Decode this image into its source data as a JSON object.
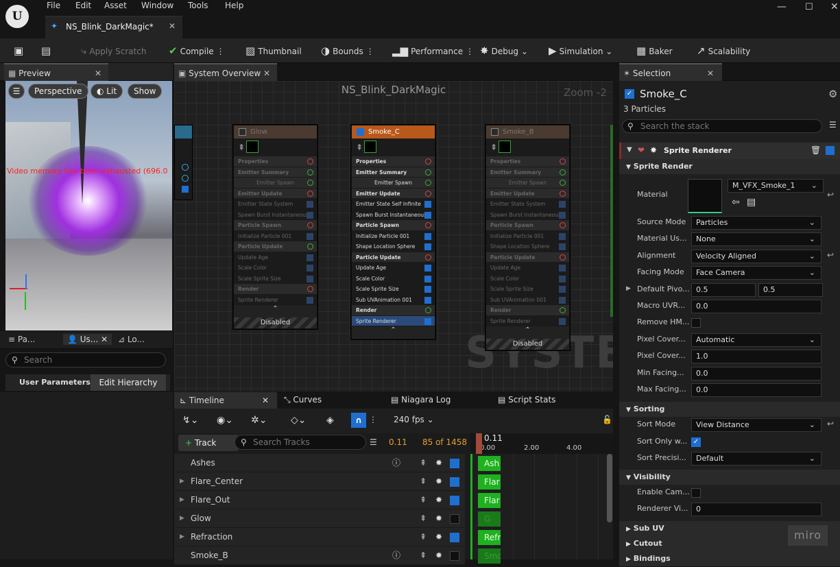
{
  "menu": [
    "File",
    "Edit",
    "Asset",
    "Window",
    "Tools",
    "Help"
  ],
  "doc_tab": "NS_Blink_DarkMagic*",
  "toolbar": {
    "apply_scratch": "Apply Scratch",
    "compile": "Compile",
    "thumbnail": "Thumbnail",
    "bounds": "Bounds",
    "performance": "Performance",
    "debug": "Debug",
    "simulation": "Simulation",
    "baker": "Baker",
    "scalability": "Scalability"
  },
  "preview": {
    "tab": "Preview",
    "perspective": "Perspective",
    "lit": "Lit",
    "show": "Show",
    "warning": "Video memory has been exhausted (696.0"
  },
  "params": {
    "tabs": [
      "Pa...",
      "Us...",
      "Lo..."
    ],
    "search_placeholder": "Search",
    "user_parameters": "User Parameters",
    "edit_hierarchy": "Edit Hierarchy"
  },
  "system_overview": {
    "tab": "System Overview",
    "title": "NS_Blink_DarkMagic",
    "zoom": "Zoom -2",
    "watermark": "SYSTEM"
  },
  "nodes": [
    {
      "name": "Glow",
      "enabled": false,
      "footer": "Disabled",
      "rows": [
        [
          "Properties",
          "sec"
        ],
        [
          "Emitter Summary",
          "sec"
        ],
        [
          "Emitter Spawn",
          "hdr"
        ],
        [
          "Emitter Update",
          "sec"
        ],
        [
          "Emitter State  System",
          ""
        ],
        [
          "Spawn Burst Instantaneous",
          ""
        ],
        [
          "Particle Spawn",
          "sec"
        ],
        [
          "Initialize Particle 001",
          ""
        ],
        [
          "Particle Update",
          "sec"
        ],
        [
          "Update Age",
          ""
        ],
        [
          "Scale Color",
          ""
        ],
        [
          "Scale Sprite Size",
          ""
        ],
        [
          "Render",
          "sec"
        ],
        [
          "Sprite Renderer",
          ""
        ]
      ]
    },
    {
      "name": "Smoke_C",
      "enabled": true,
      "footer": "",
      "rows": [
        [
          "Properties",
          "sec"
        ],
        [
          "Emitter Summary",
          "sec"
        ],
        [
          "Emitter Spawn",
          "hdr"
        ],
        [
          "Emitter Update",
          "sec"
        ],
        [
          "Emitter State  Self  Infinite",
          ""
        ],
        [
          "Spawn Burst Instantaneous",
          ""
        ],
        [
          "Particle Spawn",
          "sec"
        ],
        [
          "Initialize Particle 001",
          ""
        ],
        [
          "Shape Location  Sphere",
          ""
        ],
        [
          "Particle Update",
          "sec"
        ],
        [
          "Update Age",
          ""
        ],
        [
          "Scale Color",
          ""
        ],
        [
          "Scale Sprite Size",
          ""
        ],
        [
          "Sub UVAnimation 001",
          ""
        ],
        [
          "Render",
          "sec"
        ],
        [
          "Sprite Renderer",
          "sel"
        ]
      ]
    },
    {
      "name": "Smoke_B",
      "enabled": false,
      "footer": "Disabled",
      "rows": [
        [
          "Properties",
          "sec"
        ],
        [
          "Emitter Summary",
          "sec"
        ],
        [
          "Emitter Spawn",
          "hdr"
        ],
        [
          "Emitter Update",
          "sec"
        ],
        [
          "Emitter State  System",
          ""
        ],
        [
          "Spawn Burst Instantaneous",
          ""
        ],
        [
          "Particle Spawn",
          "sec"
        ],
        [
          "Initialize Particle 001",
          ""
        ],
        [
          "Shape Location  Sphere",
          ""
        ],
        [
          "Particle Update",
          "sec"
        ],
        [
          "Update Age",
          ""
        ],
        [
          "Scale Color",
          ""
        ],
        [
          "Scale Sprite Size",
          ""
        ],
        [
          "Sub UVAnimation 001",
          ""
        ],
        [
          "Render",
          "sec"
        ],
        [
          "Sprite Renderer",
          ""
        ]
      ]
    }
  ],
  "timeline": {
    "tabs": [
      "Timeline",
      "Curves",
      "Niagara Log",
      "Script Stats"
    ],
    "fps": "240 fps",
    "track_button": "Track",
    "search_placeholder": "Search Tracks",
    "time": "0.11",
    "frame": "85 of 1458",
    "playhead": "0.11",
    "ruler": [
      "0.00",
      "2.00",
      "4.00"
    ],
    "tracks": [
      {
        "name": "Ashes",
        "expand": false,
        "info": true,
        "enabled": true,
        "bar": "Ash"
      },
      {
        "name": "Flare_Center",
        "expand": true,
        "info": false,
        "enabled": true,
        "bar": "Flar"
      },
      {
        "name": "Flare_Out",
        "expand": true,
        "info": false,
        "enabled": true,
        "bar": "Flar"
      },
      {
        "name": "Glow",
        "expand": true,
        "info": false,
        "enabled": false,
        "bar": "G"
      },
      {
        "name": "Refraction",
        "expand": true,
        "info": false,
        "enabled": true,
        "bar": "Refr"
      },
      {
        "name": "Smoke_B",
        "expand": false,
        "info": true,
        "enabled": false,
        "bar": "Smo"
      }
    ]
  },
  "selection": {
    "tab": "Selection",
    "title": "Smoke_C",
    "count": "3 Particles",
    "search_placeholder": "Search the stack",
    "renderer": "Sprite Renderer",
    "group": "Sprite Render",
    "material": "M_VFX_Smoke_1",
    "props": [
      {
        "label": "Source Mode",
        "value": "Particles",
        "type": "select"
      },
      {
        "label": "Material Us...",
        "value": "None",
        "type": "select"
      },
      {
        "label": "Alignment",
        "value": "Velocity Aligned",
        "type": "select"
      },
      {
        "label": "Facing Mode",
        "value": "Face Camera",
        "type": "select"
      },
      {
        "label": "Default Pivo...",
        "value": "0.5",
        "value2": "0.5",
        "type": "pair"
      },
      {
        "label": "Macro UVR...",
        "value": "0.0",
        "type": "text"
      },
      {
        "label": "Remove HM...",
        "type": "check",
        "on": false
      },
      {
        "label": "Pixel Cover...",
        "value": "Automatic",
        "type": "select"
      },
      {
        "label": "Pixel Cover...",
        "value": "1.0",
        "type": "text"
      },
      {
        "label": "Min Facing...",
        "value": "0.0",
        "type": "text"
      },
      {
        "label": "Max Facing...",
        "value": "0.0",
        "type": "text"
      }
    ],
    "sorting": "Sorting",
    "sorting_props": [
      {
        "label": "Sort Mode",
        "value": "View Distance",
        "type": "select"
      },
      {
        "label": "Sort Only w...",
        "type": "check",
        "on": true
      },
      {
        "label": "Sort Precisi...",
        "value": "Default",
        "type": "select"
      }
    ],
    "visibility": "Visibility",
    "visibility_props": [
      {
        "label": "Enable Cam...",
        "type": "check",
        "on": false
      },
      {
        "label": "Renderer Vi...",
        "value": "0",
        "type": "text"
      }
    ],
    "sections": [
      "Sub UV",
      "Cutout",
      "Bindings"
    ],
    "miro": "miro"
  }
}
